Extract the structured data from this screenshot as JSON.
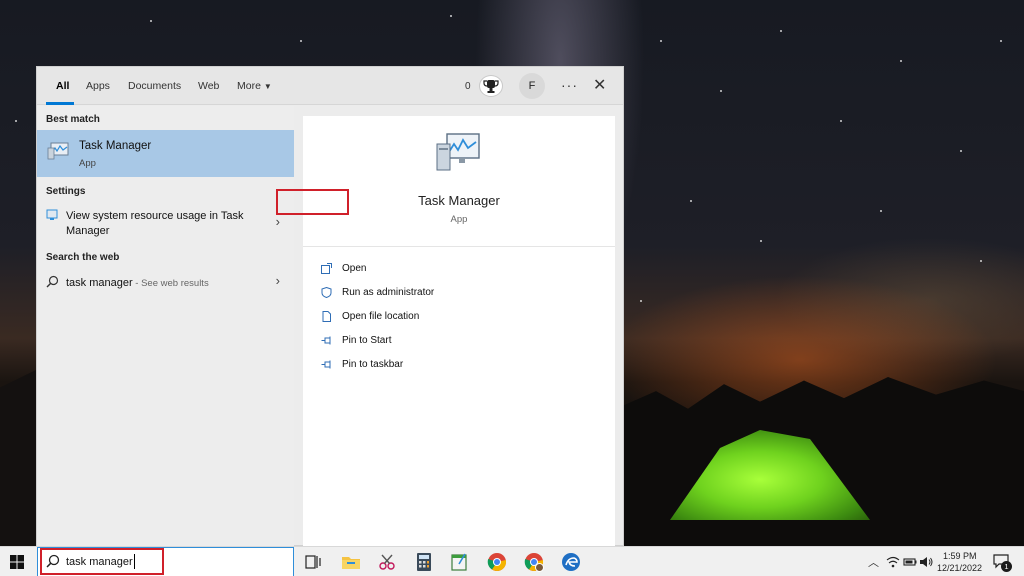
{
  "filter_bar": {
    "tabs": [
      "All",
      "Apps",
      "Documents",
      "Web",
      "More"
    ],
    "points": "0",
    "avatar_initial": "F",
    "more_options": "···"
  },
  "results": {
    "best_match_heading": "Best match",
    "best_match": {
      "title": "Task Manager",
      "subtitle": "App"
    },
    "settings_heading": "Settings",
    "settings_item": {
      "line1": "View system resource usage in Task",
      "line2": "Manager"
    },
    "web_heading": "Search the web",
    "web_item": {
      "query": "task manager",
      "suffix": " - See web results"
    }
  },
  "preview": {
    "title": "Task Manager",
    "subtitle": "App",
    "actions": [
      "Open",
      "Run as administrator",
      "Open file location",
      "Pin to Start",
      "Pin to taskbar"
    ]
  },
  "taskbar": {
    "search_value": "task manager",
    "time": "1:59 PM",
    "date": "12/21/2022",
    "notification_count": "1",
    "pinned_apps": [
      "task-view-icon",
      "file-explorer-icon",
      "snipping-tool-icon",
      "calculator-icon",
      "notepad-icon",
      "chrome-icon",
      "chrome-profile-icon",
      "edge-dev-icon"
    ]
  },
  "colors": {
    "accent": "#0078d4",
    "highlight_box": "#d0202a",
    "selected_row": "#a8c8e6"
  }
}
